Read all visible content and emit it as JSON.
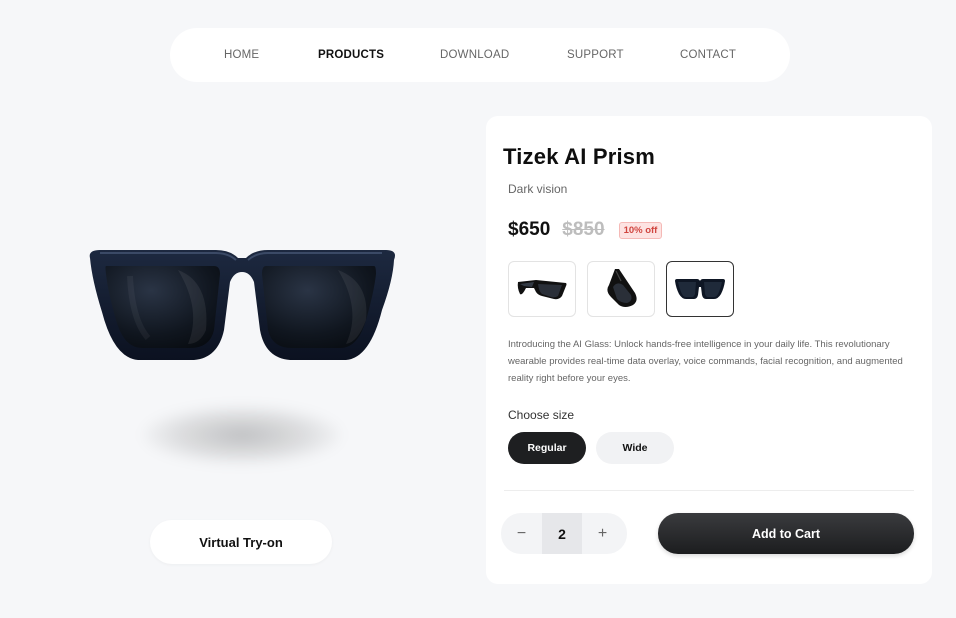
{
  "nav": {
    "items": [
      {
        "label": "HOME",
        "active": false
      },
      {
        "label": "PRODUCTS",
        "active": true
      },
      {
        "label": "DOWNLOAD",
        "active": false
      },
      {
        "label": "SUPPORT",
        "active": false
      },
      {
        "label": "CONTACT",
        "active": false
      }
    ]
  },
  "stage": {
    "product_image_icon": "sunglasses-icon",
    "tryon_label": "Virtual Try-on"
  },
  "product": {
    "title": "Tizek AI Prism",
    "subtitle": "Dark vision",
    "price": "$650",
    "old_price": "$850",
    "discount": "10% off",
    "thumbnails": [
      {
        "icon": "sunglasses-side-icon",
        "selected": false
      },
      {
        "icon": "sunglasses-folded-icon",
        "selected": false
      },
      {
        "icon": "sunglasses-front-icon",
        "selected": true
      }
    ],
    "description": "Introducing the AI Glass: Unlock hands-free intelligence in your daily life. This revolutionary wearable provides real-time data overlay, voice commands, facial recognition, and augmented reality right before your eyes.",
    "size_label": "Choose size",
    "sizes": [
      {
        "label": "Regular",
        "selected": true
      },
      {
        "label": "Wide",
        "selected": false
      }
    ],
    "quantity": {
      "minus": "−",
      "value": "2",
      "plus": "+"
    },
    "add_to_cart": "Add to Cart"
  },
  "colors": {
    "background": "#f6f7f9",
    "dark": "#1e1f21",
    "discount_text": "#d0453f",
    "discount_bg": "#fde3e2"
  }
}
